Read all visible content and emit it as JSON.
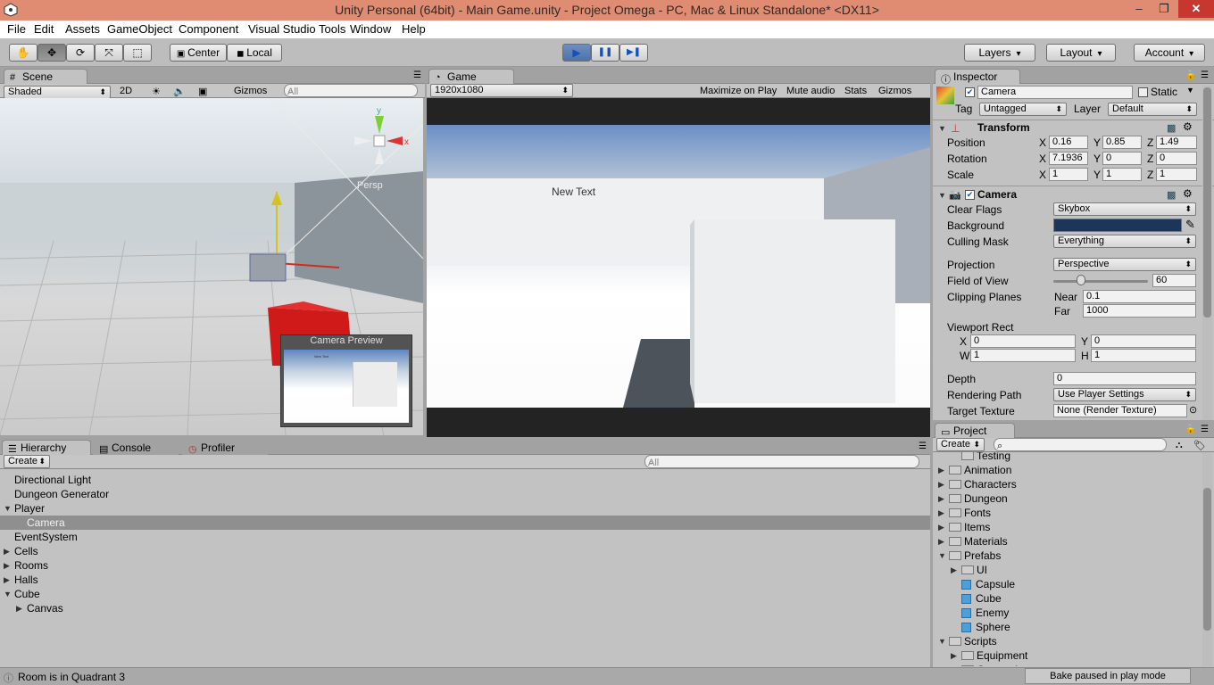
{
  "window": {
    "title": "Unity Personal (64bit) - Main Game.unity - Project Omega - PC, Mac & Linux Standalone* <DX11>",
    "minimize": "–",
    "maximize": "❐",
    "close": "✕"
  },
  "menu": [
    "File",
    "Edit",
    "Assets",
    "GameObject",
    "Component",
    "Visual Studio Tools",
    "Window",
    "Help"
  ],
  "toolbar": {
    "pivot": "Center",
    "space": "Local",
    "layers": "Layers",
    "layout": "Layout",
    "account": "Account",
    "tools": [
      "hand-icon",
      "move-icon",
      "rotate-icon",
      "scale-icon",
      "rect-icon"
    ],
    "play": "▶",
    "pause": "❚❚",
    "step": "▶❚"
  },
  "scene": {
    "tab": "Scene",
    "shading": "Shaded",
    "mode2d": "2D",
    "gizmos": "Gizmos",
    "search_placeholder": "All",
    "persp": "Persp",
    "preview_title": "Camera Preview",
    "preview_text": "New Text"
  },
  "game": {
    "tab": "Game",
    "resolution": "1920x1080",
    "buttons": [
      "Maximize on Play",
      "Mute audio",
      "Stats",
      "Gizmos"
    ],
    "canvas_text": "New Text"
  },
  "inspector": {
    "tab": "Inspector",
    "object_name": "Camera",
    "static_label": "Static",
    "tag_label": "Tag",
    "tag_value": "Untagged",
    "layer_label": "Layer",
    "layer_value": "Default",
    "transform": {
      "title": "Transform",
      "rows": [
        {
          "label": "Position",
          "x": "0.16",
          "y": "0.85",
          "z": "1.49"
        },
        {
          "label": "Rotation",
          "x": "7.1936",
          "y": "0",
          "z": "0"
        },
        {
          "label": "Scale",
          "x": "1",
          "y": "1",
          "z": "1"
        }
      ]
    },
    "camera": {
      "title": "Camera",
      "clear_flags_label": "Clear Flags",
      "clear_flags": "Skybox",
      "background_label": "Background",
      "background_color": "#1d355a",
      "culling_label": "Culling Mask",
      "culling": "Everything",
      "projection_label": "Projection",
      "projection": "Perspective",
      "fov_label": "Field of View",
      "fov": "60",
      "fov_fraction": 0.29,
      "clipping_label": "Clipping Planes",
      "near_label": "Near",
      "near": "0.1",
      "far_label": "Far",
      "far": "1000",
      "viewport_label": "Viewport Rect",
      "vx": "0",
      "vy": "0",
      "vw": "1",
      "vh": "1",
      "x_label": "X",
      "y_label": "Y",
      "w_label": "W",
      "h_label": "H",
      "depth_label": "Depth",
      "depth": "0",
      "render_path_label": "Rendering Path",
      "render_path": "Use Player Settings",
      "target_label": "Target Texture",
      "target": "None (Render Texture)"
    }
  },
  "hierarchy": {
    "tabs": [
      "Hierarchy",
      "Console",
      "Profiler"
    ],
    "create": "Create",
    "search_placeholder": "All",
    "items": [
      {
        "label": "Directional Light",
        "depth": 0,
        "arrow": ""
      },
      {
        "label": "Dungeon Generator",
        "depth": 0,
        "arrow": ""
      },
      {
        "label": "Player",
        "depth": 0,
        "arrow": "▼"
      },
      {
        "label": "Camera",
        "depth": 1,
        "arrow": "",
        "selected": true
      },
      {
        "label": "EventSystem",
        "depth": 0,
        "arrow": ""
      },
      {
        "label": "Cells",
        "depth": 0,
        "arrow": "▶"
      },
      {
        "label": "Rooms",
        "depth": 0,
        "arrow": "▶"
      },
      {
        "label": "Halls",
        "depth": 0,
        "arrow": "▶"
      },
      {
        "label": "Cube",
        "depth": 0,
        "arrow": "▼"
      },
      {
        "label": "Canvas",
        "depth": 1,
        "arrow": "▶"
      }
    ]
  },
  "project": {
    "tab": "Project",
    "create": "Create",
    "items": [
      {
        "label": "Testing",
        "depth": 1,
        "kind": "folder",
        "arrow": ""
      },
      {
        "label": "Animation",
        "depth": 0,
        "kind": "folder",
        "arrow": "▶"
      },
      {
        "label": "Characters",
        "depth": 0,
        "kind": "folder",
        "arrow": "▶"
      },
      {
        "label": "Dungeon",
        "depth": 0,
        "kind": "folder",
        "arrow": "▶"
      },
      {
        "label": "Fonts",
        "depth": 0,
        "kind": "folder",
        "arrow": "▶"
      },
      {
        "label": "Items",
        "depth": 0,
        "kind": "folder",
        "arrow": "▶"
      },
      {
        "label": "Materials",
        "depth": 0,
        "kind": "folder",
        "arrow": "▶"
      },
      {
        "label": "Prefabs",
        "depth": 0,
        "kind": "folder",
        "arrow": "▼"
      },
      {
        "label": "UI",
        "depth": 1,
        "kind": "folder",
        "arrow": "▶"
      },
      {
        "label": "Capsule",
        "depth": 1,
        "kind": "prefab",
        "arrow": ""
      },
      {
        "label": "Cube",
        "depth": 1,
        "kind": "prefab",
        "arrow": ""
      },
      {
        "label": "Enemy",
        "depth": 1,
        "kind": "prefab",
        "arrow": ""
      },
      {
        "label": "Sphere",
        "depth": 1,
        "kind": "prefab",
        "arrow": ""
      },
      {
        "label": "Scripts",
        "depth": 0,
        "kind": "folder",
        "arrow": "▼"
      },
      {
        "label": "Equipment",
        "depth": 1,
        "kind": "folder",
        "arrow": "▶"
      },
      {
        "label": "Generation",
        "depth": 1,
        "kind": "folder",
        "arrow": "▶"
      }
    ]
  },
  "status": {
    "message": "Room is in Quadrant 3",
    "bake": "Bake paused in play mode"
  }
}
